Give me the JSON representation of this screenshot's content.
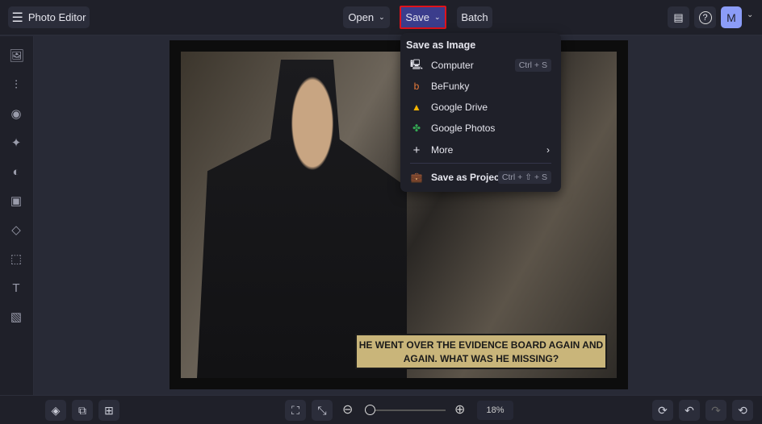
{
  "header": {
    "menu_icon": "hamburger-icon",
    "title": "Photo Editor",
    "open_label": "Open",
    "save_label": "Save",
    "batch_label": "Batch",
    "avatar_initial": "M"
  },
  "save_menu": {
    "heading": "Save as Image",
    "items": [
      {
        "label": "Computer",
        "shortcut": "Ctrl + S",
        "icon": "monitor-icon"
      },
      {
        "label": "BeFunky",
        "icon": "befunky-icon"
      },
      {
        "label": "Google Drive",
        "icon": "google-drive-icon"
      },
      {
        "label": "Google Photos",
        "icon": "google-photos-icon"
      },
      {
        "label": "More",
        "icon": "plus-icon"
      }
    ],
    "project": {
      "label": "Save as Project",
      "shortcut": "Ctrl + ⇧ + S"
    }
  },
  "canvas": {
    "caption": "HE WENT OVER THE EVIDENCE BOARD AGAIN AND AGAIN. WHAT WAS HE MISSING?"
  },
  "footer": {
    "zoom": "18%",
    "zoom_fraction": 0.02
  },
  "colors": {
    "accent": "#3b3d8c",
    "highlight": "#e0131b",
    "avatar": "#8b9cf7"
  }
}
